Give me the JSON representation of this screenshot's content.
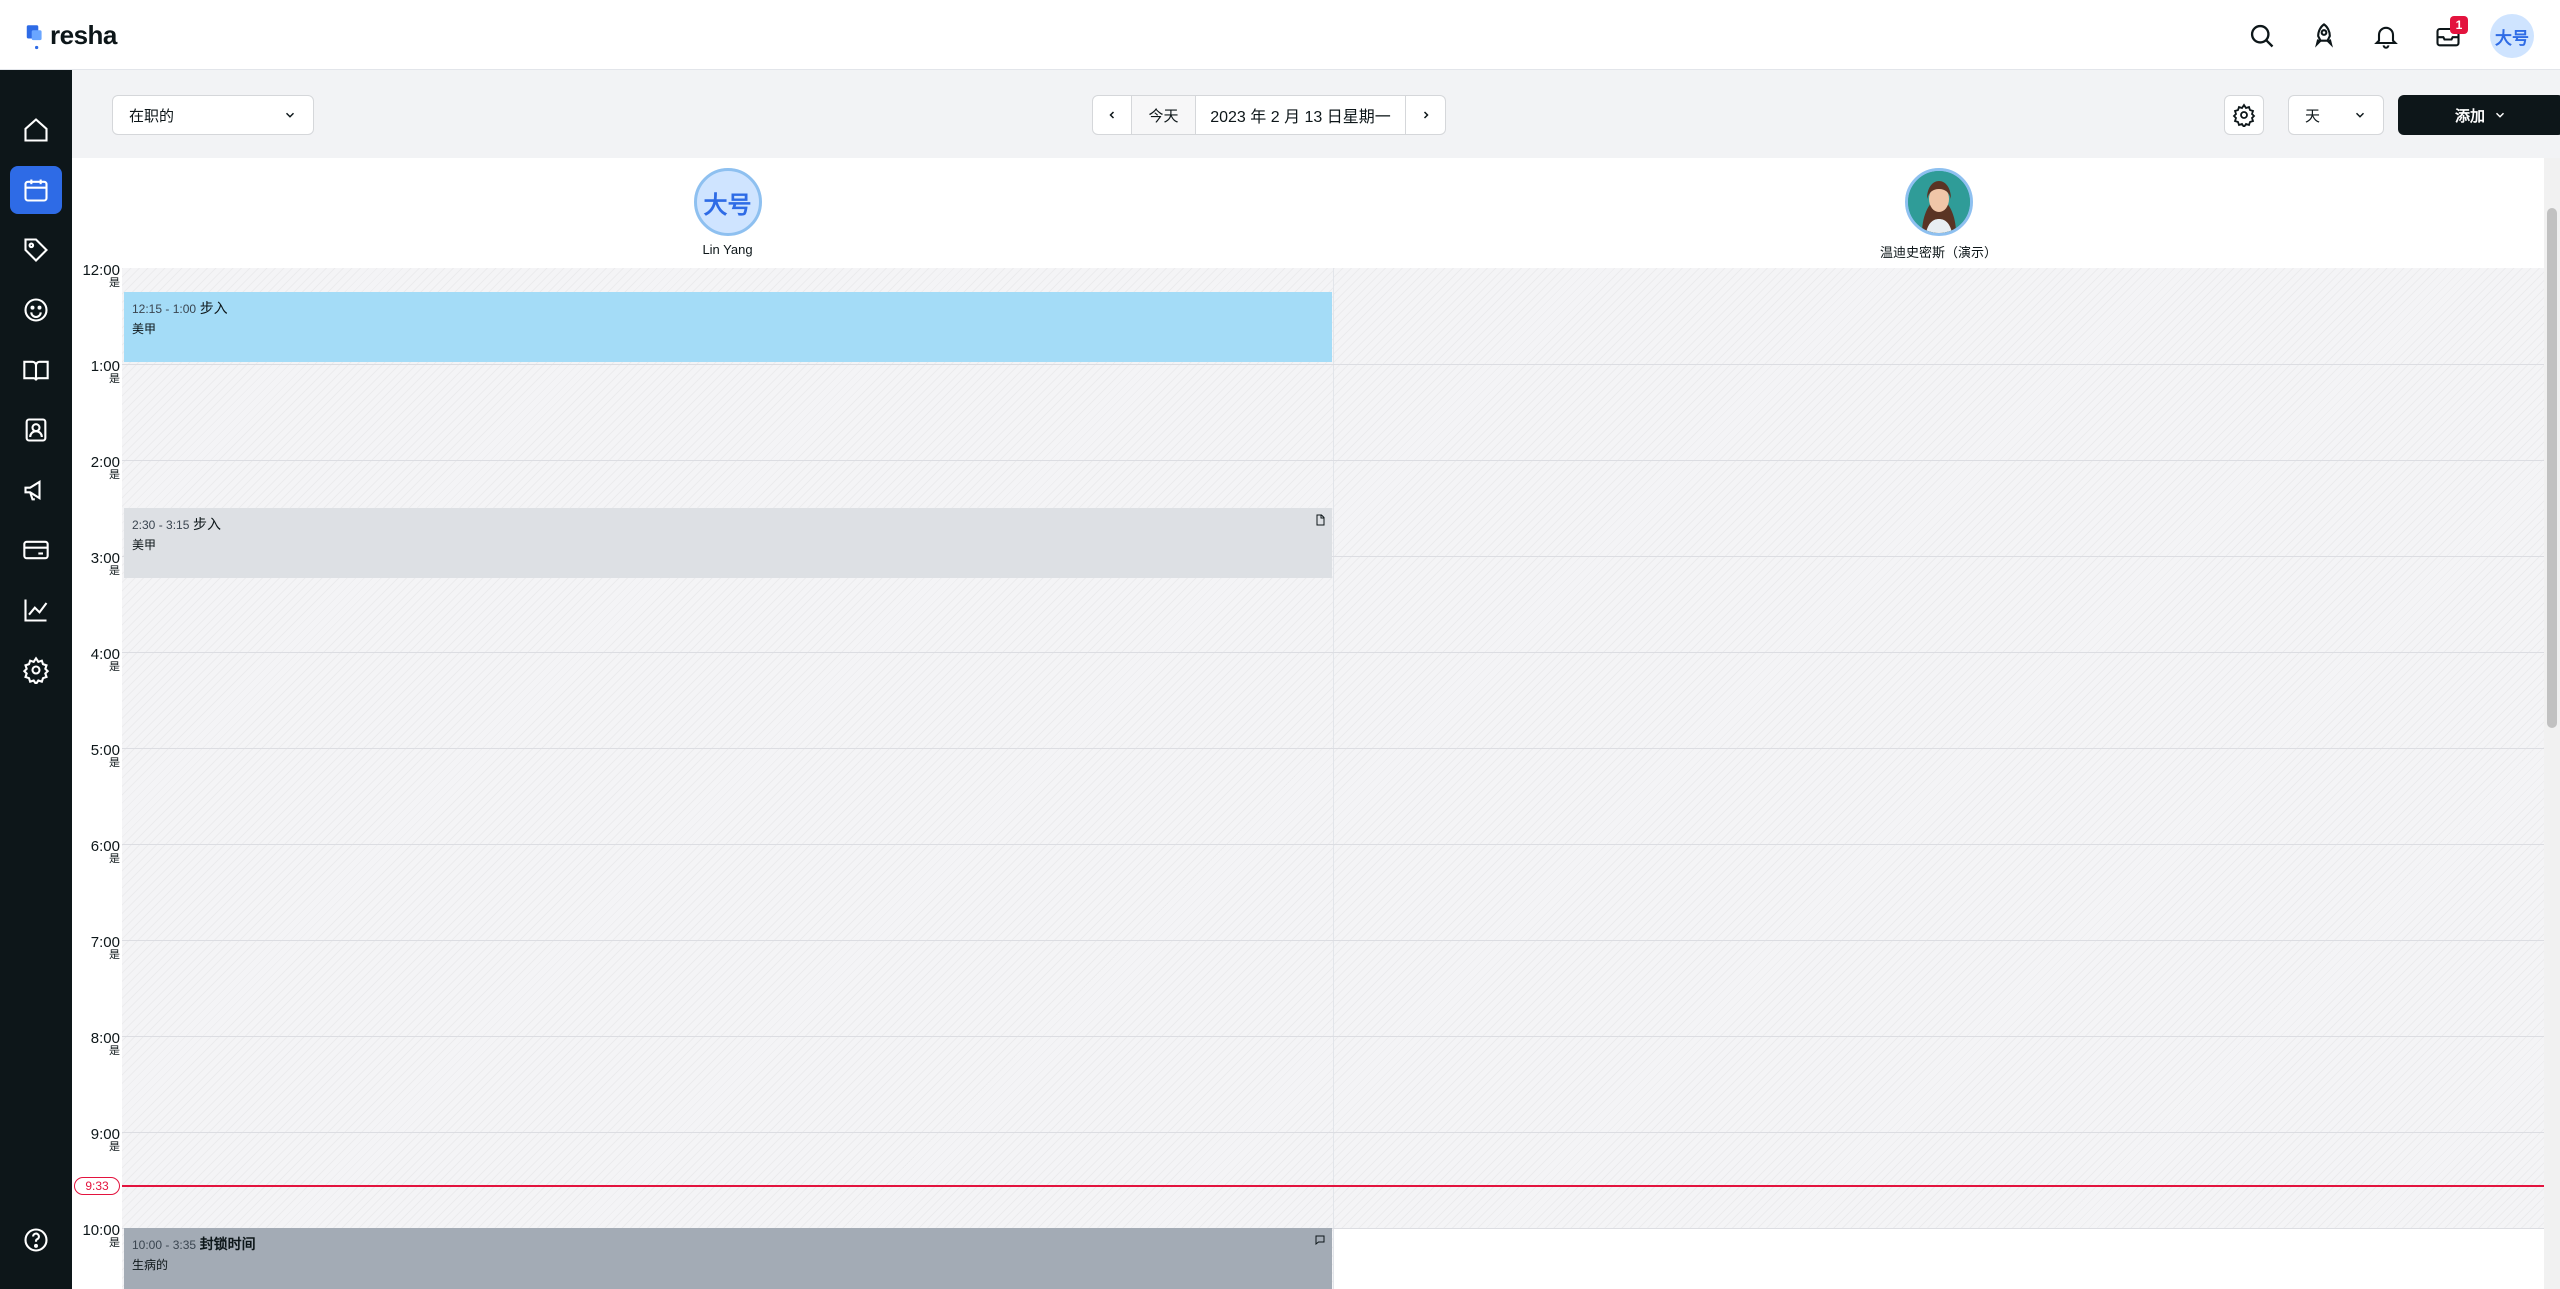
{
  "app": {
    "logo_text": "resha"
  },
  "topbar": {
    "notification_badge": "1",
    "user_initials": "大号"
  },
  "sidebar": {
    "items": [
      {
        "name": "home",
        "icon": "home-icon"
      },
      {
        "name": "calendar",
        "icon": "calendar-icon",
        "active": true
      },
      {
        "name": "sales",
        "icon": "tag-icon"
      },
      {
        "name": "clients",
        "icon": "smiley-icon"
      },
      {
        "name": "catalog",
        "icon": "book-icon"
      },
      {
        "name": "team",
        "icon": "contact-card-icon"
      },
      {
        "name": "marketing",
        "icon": "megaphone-icon"
      },
      {
        "name": "payments",
        "icon": "card-icon"
      },
      {
        "name": "reports",
        "icon": "chart-icon"
      },
      {
        "name": "settings",
        "icon": "gear-icon"
      }
    ],
    "help_icon": "help-icon"
  },
  "toolbar": {
    "staff_filter": "在职的",
    "today_label": "今天",
    "date_label": "2023 年 2 月 13 日星期一",
    "view_mode": "天",
    "add_label": "添加"
  },
  "calendar": {
    "columns": [
      {
        "name": "Lin Yang",
        "initials": "大号"
      },
      {
        "name": "温迪史密斯（演示）"
      }
    ],
    "hours": [
      {
        "label": "12:00",
        "suffix": "是"
      },
      {
        "label": "1:00",
        "suffix": "是"
      },
      {
        "label": "2:00",
        "suffix": "是"
      },
      {
        "label": "3:00",
        "suffix": "是"
      },
      {
        "label": "4:00",
        "suffix": "是"
      },
      {
        "label": "5:00",
        "suffix": "是"
      },
      {
        "label": "6:00",
        "suffix": "是"
      },
      {
        "label": "7:00",
        "suffix": "是"
      },
      {
        "label": "8:00",
        "suffix": "是"
      },
      {
        "label": "9:00",
        "suffix": "是"
      },
      {
        "label": "10:00",
        "suffix": "是"
      }
    ],
    "current_time": "9:33",
    "appointments": [
      {
        "time": "12:15 - 1:00",
        "title": "步入",
        "service": "美甲",
        "color": "#a4dcf7"
      },
      {
        "time": "2:30 - 3:15",
        "title": "步入",
        "service": "美甲",
        "color": "#dde0e4",
        "icon": "note-icon"
      },
      {
        "time": "10:00 - 3:35",
        "title": "封锁时间",
        "service": "生病的",
        "color": "#a3abb5",
        "icon": "comment-icon"
      }
    ]
  }
}
